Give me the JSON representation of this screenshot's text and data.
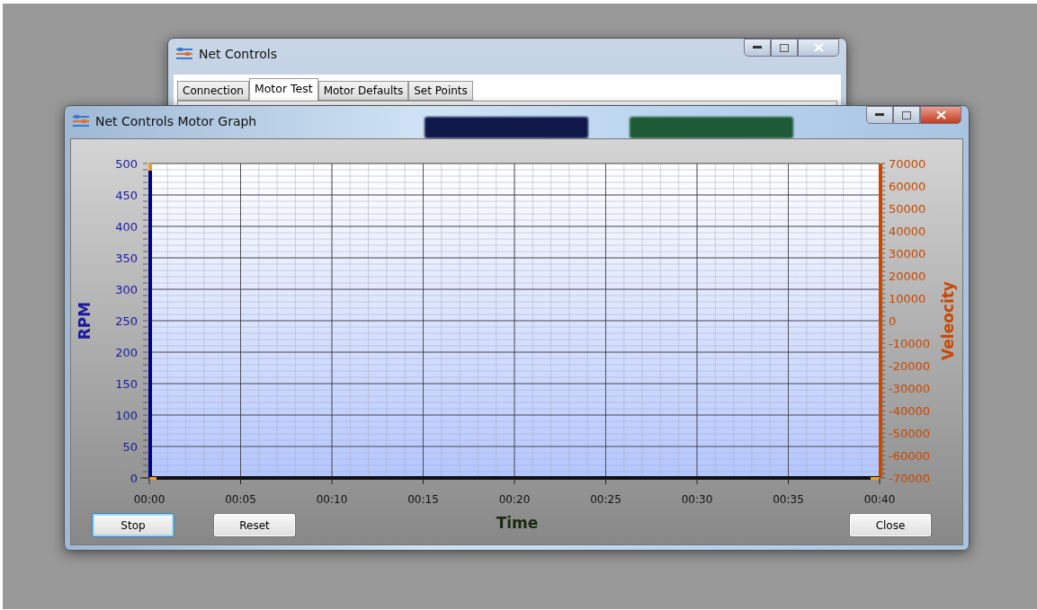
{
  "back_window": {
    "title": "Net Controls",
    "tabs": [
      {
        "label": "Connection",
        "selected": false
      },
      {
        "label": "Motor Test",
        "selected": true
      },
      {
        "label": "Motor Defaults",
        "selected": false
      },
      {
        "label": "Set Points",
        "selected": false
      }
    ]
  },
  "graph_window": {
    "title": "Net Controls Motor Graph",
    "chart_data": {
      "type": "line",
      "grid": true,
      "xlabel": "Time",
      "ylabel": "RPM",
      "y2label": "Veleocity",
      "xlim": [
        0,
        40
      ],
      "ylim": [
        0,
        500
      ],
      "y2lim": [
        -70000,
        70000
      ],
      "xticks": [
        {
          "value": 0,
          "label": "00:00"
        },
        {
          "value": 5,
          "label": "00:05"
        },
        {
          "value": 10,
          "label": "00:10"
        },
        {
          "value": 15,
          "label": "00:15"
        },
        {
          "value": 20,
          "label": "00:20"
        },
        {
          "value": 25,
          "label": "00:25"
        },
        {
          "value": 30,
          "label": "00:30"
        },
        {
          "value": 35,
          "label": "00:35"
        },
        {
          "value": 40,
          "label": "00:40"
        }
      ],
      "yticks": [
        0,
        50,
        100,
        150,
        200,
        250,
        300,
        350,
        400,
        450,
        500
      ],
      "y2ticks": [
        -70000,
        -60000,
        -50000,
        -40000,
        -30000,
        -20000,
        -10000,
        0,
        10000,
        20000,
        30000,
        40000,
        50000,
        60000,
        70000
      ]
    },
    "buttons": [
      {
        "label": "Stop",
        "focused": true
      },
      {
        "label": "Reset",
        "focused": false
      },
      {
        "label": "Close",
        "focused": false
      }
    ]
  }
}
